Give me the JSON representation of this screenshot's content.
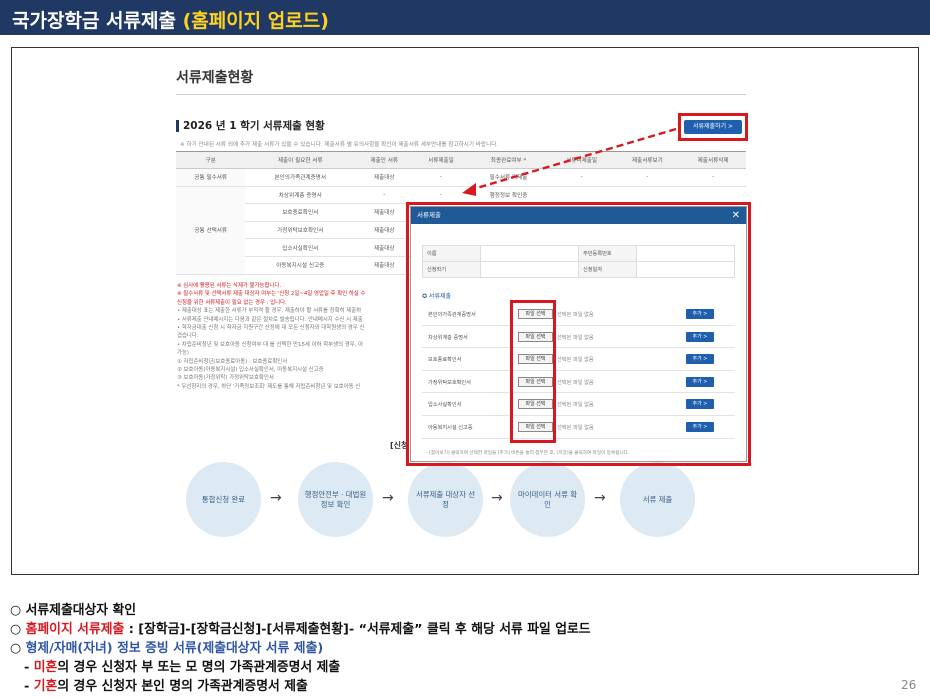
{
  "header": {
    "title_main": "국가장학금 서류제출 ",
    "title_highlight": "(홈페이지 업로드)"
  },
  "screen": {
    "page_title": "서류제출현황",
    "section_title": "2026 년 1 학기 서류제출 현황",
    "section_note": "※ 하기 안내된 서류 외에 추가 제출 서류가 있을 수 있습니다. 제출서류 별 유의사항을 확인이 제출서류 세부안내를 참고하시기 바랍니다.",
    "submit_button": "서류제출하기 >",
    "table_headers": [
      "구분",
      "제출이 필요한 서류",
      "제출인 서류",
      "서류제출일",
      "최종완료여부 *",
      "서류미제출일",
      "제출서류보기",
      "제출서류삭제"
    ],
    "table_rows": [
      {
        "group": "공통 필수서류",
        "doc": "본인의가족관계증명서",
        "target": "제출대상",
        "date": "-",
        "status": "필수서류 미제출",
        "c6": "-",
        "c7": "-",
        "c8": "-"
      },
      {
        "group": "공통 선택서류",
        "doc": "차상위계층 증명서",
        "target": "-",
        "date": "-",
        "status": "행정정보 확인중",
        "c6": "",
        "c7": "",
        "c8": ""
      },
      {
        "group": "",
        "doc": "보호종료확인서",
        "target": "제출대상",
        "date": "",
        "status": "",
        "c6": "",
        "c7": "",
        "c8": ""
      },
      {
        "group": "",
        "doc": "가정위탁보호확인서",
        "target": "제출대상",
        "date": "",
        "status": "",
        "c6": "",
        "c7": "",
        "c8": ""
      },
      {
        "group": "",
        "doc": "입소사실확인서",
        "target": "제출대상",
        "date": "",
        "status": "",
        "c6": "",
        "c7": "",
        "c8": ""
      },
      {
        "group": "",
        "doc": "아동복지시설 신고증",
        "target": "제출대상",
        "date": "",
        "status": "",
        "c6": "",
        "c7": "",
        "c8": ""
      }
    ],
    "notes": [
      "※ 심사에 활용된 서류는 삭제가 불가능합니다.",
      "※ 필수서류 및 선택서류 제출 대상자 여부는 '신청 2일~4일 영업일 후 확인 하실 수",
      "   신청을 위한 서류제출이 필요 없는 경우 : 입니다.",
      "• 제출대상 표는 제출한 서류가 부적격 할 경우, 재출하야 할 서류를 정확히 제출하",
      "• 서류제출 안내메시지는 다음과 같은 절차로 발송됩니다. 안내메시지 수신 시 제출",
      "• 학자금대출 신청 시 학자금 지원구간 산정에 대 모든 신청자와 대학원생의 경우 신",
      "  겹습니다.",
      "• 차립준비청년 및 보호아동 신청여부 대 를 선택한 만15세 이하 학부생의 경우, 아",
      "  가능)",
      "  ① 자립준비청년(보호종료아동) : 보호종료확인서",
      "  ② 보호아동(아동복지시설) 입소사실확인서, 아동복지시설 신고증",
      "  ③ 보호아동(가정위탁) 가정위탁보호확인서",
      "  * 우선창리의 경우, 하단 '가족정보조회' 제도를 통해 자립준비청년 및 보호아동 신"
    ],
    "apply_title": "[신청",
    "flow_steps": [
      "통합신청 완료",
      "행정안전부 · 대법원 정보 확인",
      "서류제출 대상자 선정",
      "마이데이터 서류 확인",
      "서류 제출"
    ],
    "flow_arrow": "→"
  },
  "modal": {
    "title": "서류제출",
    "close": "✕",
    "info": [
      {
        "k1": "이름",
        "k2": "주민등록번호"
      },
      {
        "k1": "신청학기",
        "k2": "신청일자"
      }
    ],
    "subtitle": "✪ 서류제출",
    "docs": [
      {
        "name": "본인의가족관계증명서",
        "file_btn": "파일 선택",
        "status": "선택된 파일 없음",
        "add": "추가 >"
      },
      {
        "name": "차상위계층 증명서",
        "file_btn": "파일 선택",
        "status": "선택된 파일 없음",
        "add": "추가 >"
      },
      {
        "name": "보호종료확인서",
        "file_btn": "파일 선택",
        "status": "선택된 파일 없음",
        "add": "추가 >"
      },
      {
        "name": "가정위탁보호확인서",
        "file_btn": "파일 선택",
        "status": "선택된 파일 없음",
        "add": "추가 >"
      },
      {
        "name": "입소사실확인서",
        "file_btn": "파일 선택",
        "status": "선택된 파일 없음",
        "add": "추가 >"
      },
      {
        "name": "아동복지시설 신고증",
        "file_btn": "파일 선택",
        "status": "선택된 파일 없음",
        "add": "추가 >"
      }
    ],
    "footer": "- [찾아보기] 클릭하여 선택한 파일을 [추가] 버튼을 눌러 첨부한 후, [저장]을 클릭하여 파일이 등록됩니다."
  },
  "bullets": {
    "b1": "○ 서류제출대상자 확인",
    "b2_prefix": "○ ",
    "b2_red": "홈페이지 서류제출",
    "b2_rest": " : [장학금]-[장학금신청]-[서류제출현황]- “서류제출” 클릭 후 해당 서류 파일 업로드",
    "b3_prefix": "○ ",
    "b3_blue": "형제/자매(자녀) 정보 증빙 서류(제출대상자 서류 제출)",
    "b4_prefix": "- ",
    "b4_red": "미혼",
    "b4_rest": "의 경우 신청자 부 또는 모 명의 가족관계증명서 제출",
    "b5_prefix": "- ",
    "b5_red": "기혼",
    "b5_rest": "의 경우 신청자 본인 명의 가족관계증명서 제출"
  },
  "page_number": "26",
  "colors": {
    "header_bg": "#1f3864",
    "highlight": "#ffd21f",
    "red": "#d8181f",
    "blue": "#2f56a6"
  }
}
